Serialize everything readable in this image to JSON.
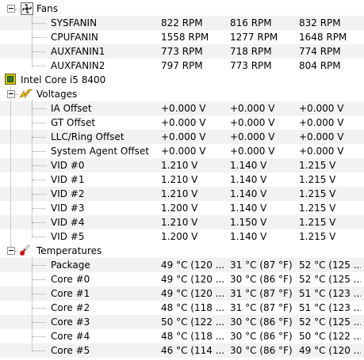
{
  "fans": {
    "label": "Fans",
    "icon": "fan-icon",
    "rows": [
      {
        "name": "SYSFANIN",
        "v1": "822 RPM",
        "v2": "816 RPM",
        "v3": "832 RPM"
      },
      {
        "name": "CPUFANIN",
        "v1": "1558 RPM",
        "v2": "1277 RPM",
        "v3": "1648 RPM"
      },
      {
        "name": "AUXFANIN1",
        "v1": "773 RPM",
        "v2": "718 RPM",
        "v3": "774 RPM"
      },
      {
        "name": "AUXFANIN2",
        "v1": "797 RPM",
        "v2": "773 RPM",
        "v3": "804 RPM"
      }
    ]
  },
  "cpu": {
    "label": "Intel Core i5 8400",
    "icon": "cpu-chip-icon"
  },
  "voltages": {
    "label": "Voltages",
    "icon": "voltage-bolt-icon",
    "rows": [
      {
        "name": "IA Offset",
        "v1": "+0.000 V",
        "v2": "+0.000 V",
        "v3": "+0.000 V"
      },
      {
        "name": "GT Offset",
        "v1": "+0.000 V",
        "v2": "+0.000 V",
        "v3": "+0.000 V"
      },
      {
        "name": "LLC/Ring Offset",
        "v1": "+0.000 V",
        "v2": "+0.000 V",
        "v3": "+0.000 V"
      },
      {
        "name": "System Agent Offset",
        "v1": "+0.000 V",
        "v2": "+0.000 V",
        "v3": "+0.000 V"
      },
      {
        "name": "VID #0",
        "v1": "1.210 V",
        "v2": "1.140 V",
        "v3": "1.215 V"
      },
      {
        "name": "VID #1",
        "v1": "1.210 V",
        "v2": "1.140 V",
        "v3": "1.215 V"
      },
      {
        "name": "VID #2",
        "v1": "1.210 V",
        "v2": "1.140 V",
        "v3": "1.215 V"
      },
      {
        "name": "VID #3",
        "v1": "1.200 V",
        "v2": "1.140 V",
        "v3": "1.215 V"
      },
      {
        "name": "VID #4",
        "v1": "1.210 V",
        "v2": "1.150 V",
        "v3": "1.215 V"
      },
      {
        "name": "VID #5",
        "v1": "1.200 V",
        "v2": "1.140 V",
        "v3": "1.215 V"
      }
    ]
  },
  "temperatures": {
    "label": "Temperatures",
    "icon": "thermometer-icon",
    "rows": [
      {
        "name": "Package",
        "v1": "49 °C  (120 ...",
        "v2": "31 °C  (87 °F)",
        "v3": "52 °C  (125 ..."
      },
      {
        "name": "Core #0",
        "v1": "49 °C  (120 ...",
        "v2": "30 °C  (86 °F)",
        "v3": "52 °C  (125 ..."
      },
      {
        "name": "Core #1",
        "v1": "49 °C  (120 ...",
        "v2": "31 °C  (87 °F)",
        "v3": "51 °C  (123 ..."
      },
      {
        "name": "Core #2",
        "v1": "48 °C  (118 ...",
        "v2": "31 °C  (87 °F)",
        "v3": "51 °C  (123 ..."
      },
      {
        "name": "Core #3",
        "v1": "50 °C  (122 ...",
        "v2": "30 °C  (86 °F)",
        "v3": "52 °C  (125 ..."
      },
      {
        "name": "Core #4",
        "v1": "48 °C  (118 ...",
        "v2": "30 °C  (86 °F)",
        "v3": "50 °C  (122 ..."
      },
      {
        "name": "Core #5",
        "v1": "46 °C  (114 ...",
        "v2": "30 °C  (86 °F)",
        "v3": "49 °C  (120 ..."
      }
    ]
  },
  "colors": {
    "alt_row": "#f2f2f2",
    "tree_line": "#a0a0a0",
    "cpu_icon": "#d4c600",
    "bolt_icon": "#f0b400",
    "thermometer_icon": "#d01010"
  }
}
